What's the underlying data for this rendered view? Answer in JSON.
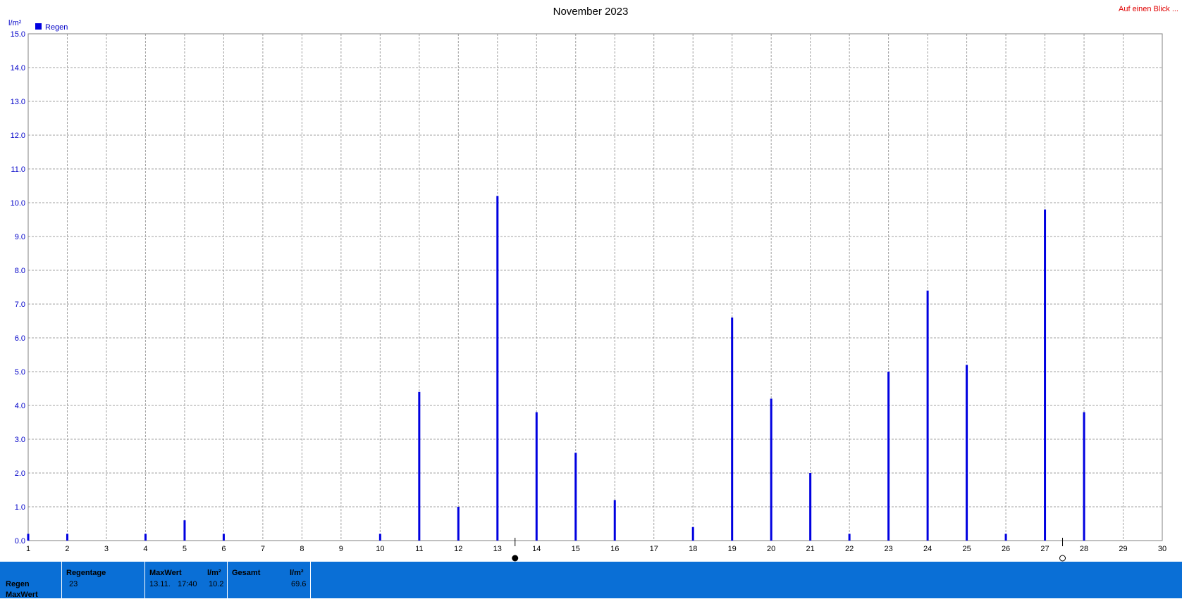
{
  "header": {
    "title": "November 2023",
    "link_label": "Auf einen Blick ..."
  },
  "chart_data": {
    "type": "bar",
    "title": "November 2023",
    "ylabel": "l/m²",
    "ylim": [
      0,
      15
    ],
    "y_ticks": [
      "0.0",
      "1.0",
      "2.0",
      "3.0",
      "4.0",
      "5.0",
      "6.0",
      "7.0",
      "8.0",
      "9.0",
      "10.0",
      "11.0",
      "12.0",
      "13.0",
      "14.0",
      "15.0"
    ],
    "xlim": [
      1,
      30
    ],
    "x_ticks": [
      "1",
      "2",
      "3",
      "4",
      "5",
      "6",
      "7",
      "8",
      "9",
      "10",
      "11",
      "12",
      "13",
      "14",
      "15",
      "16",
      "17",
      "18",
      "19",
      "20",
      "21",
      "22",
      "23",
      "24",
      "25",
      "26",
      "27",
      "28",
      "29",
      "30"
    ],
    "grid": true,
    "legend": "top-left",
    "series": [
      {
        "name": "Regen",
        "color": "#0000e0",
        "x": [
          1,
          2,
          4,
          5,
          6,
          10,
          11,
          12,
          13,
          14,
          15,
          16,
          18,
          19,
          20,
          21,
          22,
          23,
          24,
          25,
          26,
          27,
          28
        ],
        "values": [
          0.2,
          0.2,
          0.2,
          0.6,
          0.2,
          0.2,
          4.4,
          1.0,
          10.2,
          3.8,
          2.6,
          1.2,
          0.4,
          6.6,
          4.2,
          2.0,
          0.2,
          5.0,
          7.4,
          5.2,
          0.2,
          9.8,
          3.8
        ]
      }
    ],
    "moon_markers": [
      {
        "x": 13.45,
        "phase": "full-moon"
      },
      {
        "x": 27.45,
        "phase": "new-moon"
      }
    ]
  },
  "footer": {
    "row_labels": [
      "Regen",
      "MaxWert"
    ],
    "regentage": {
      "header": "Regentage",
      "value": "23"
    },
    "maxwert": {
      "header": "MaxWert",
      "unit": "l/m²",
      "date": "13.11.",
      "time": "17:40",
      "value": "10.2"
    },
    "gesamt": {
      "header": "Gesamt",
      "unit": "l/m²",
      "value": "69.6"
    }
  },
  "colors": {
    "footer_bg": "#0a6fd6",
    "bar": "#0000e0",
    "axis_text": "#0000c8",
    "link": "#e00000"
  }
}
